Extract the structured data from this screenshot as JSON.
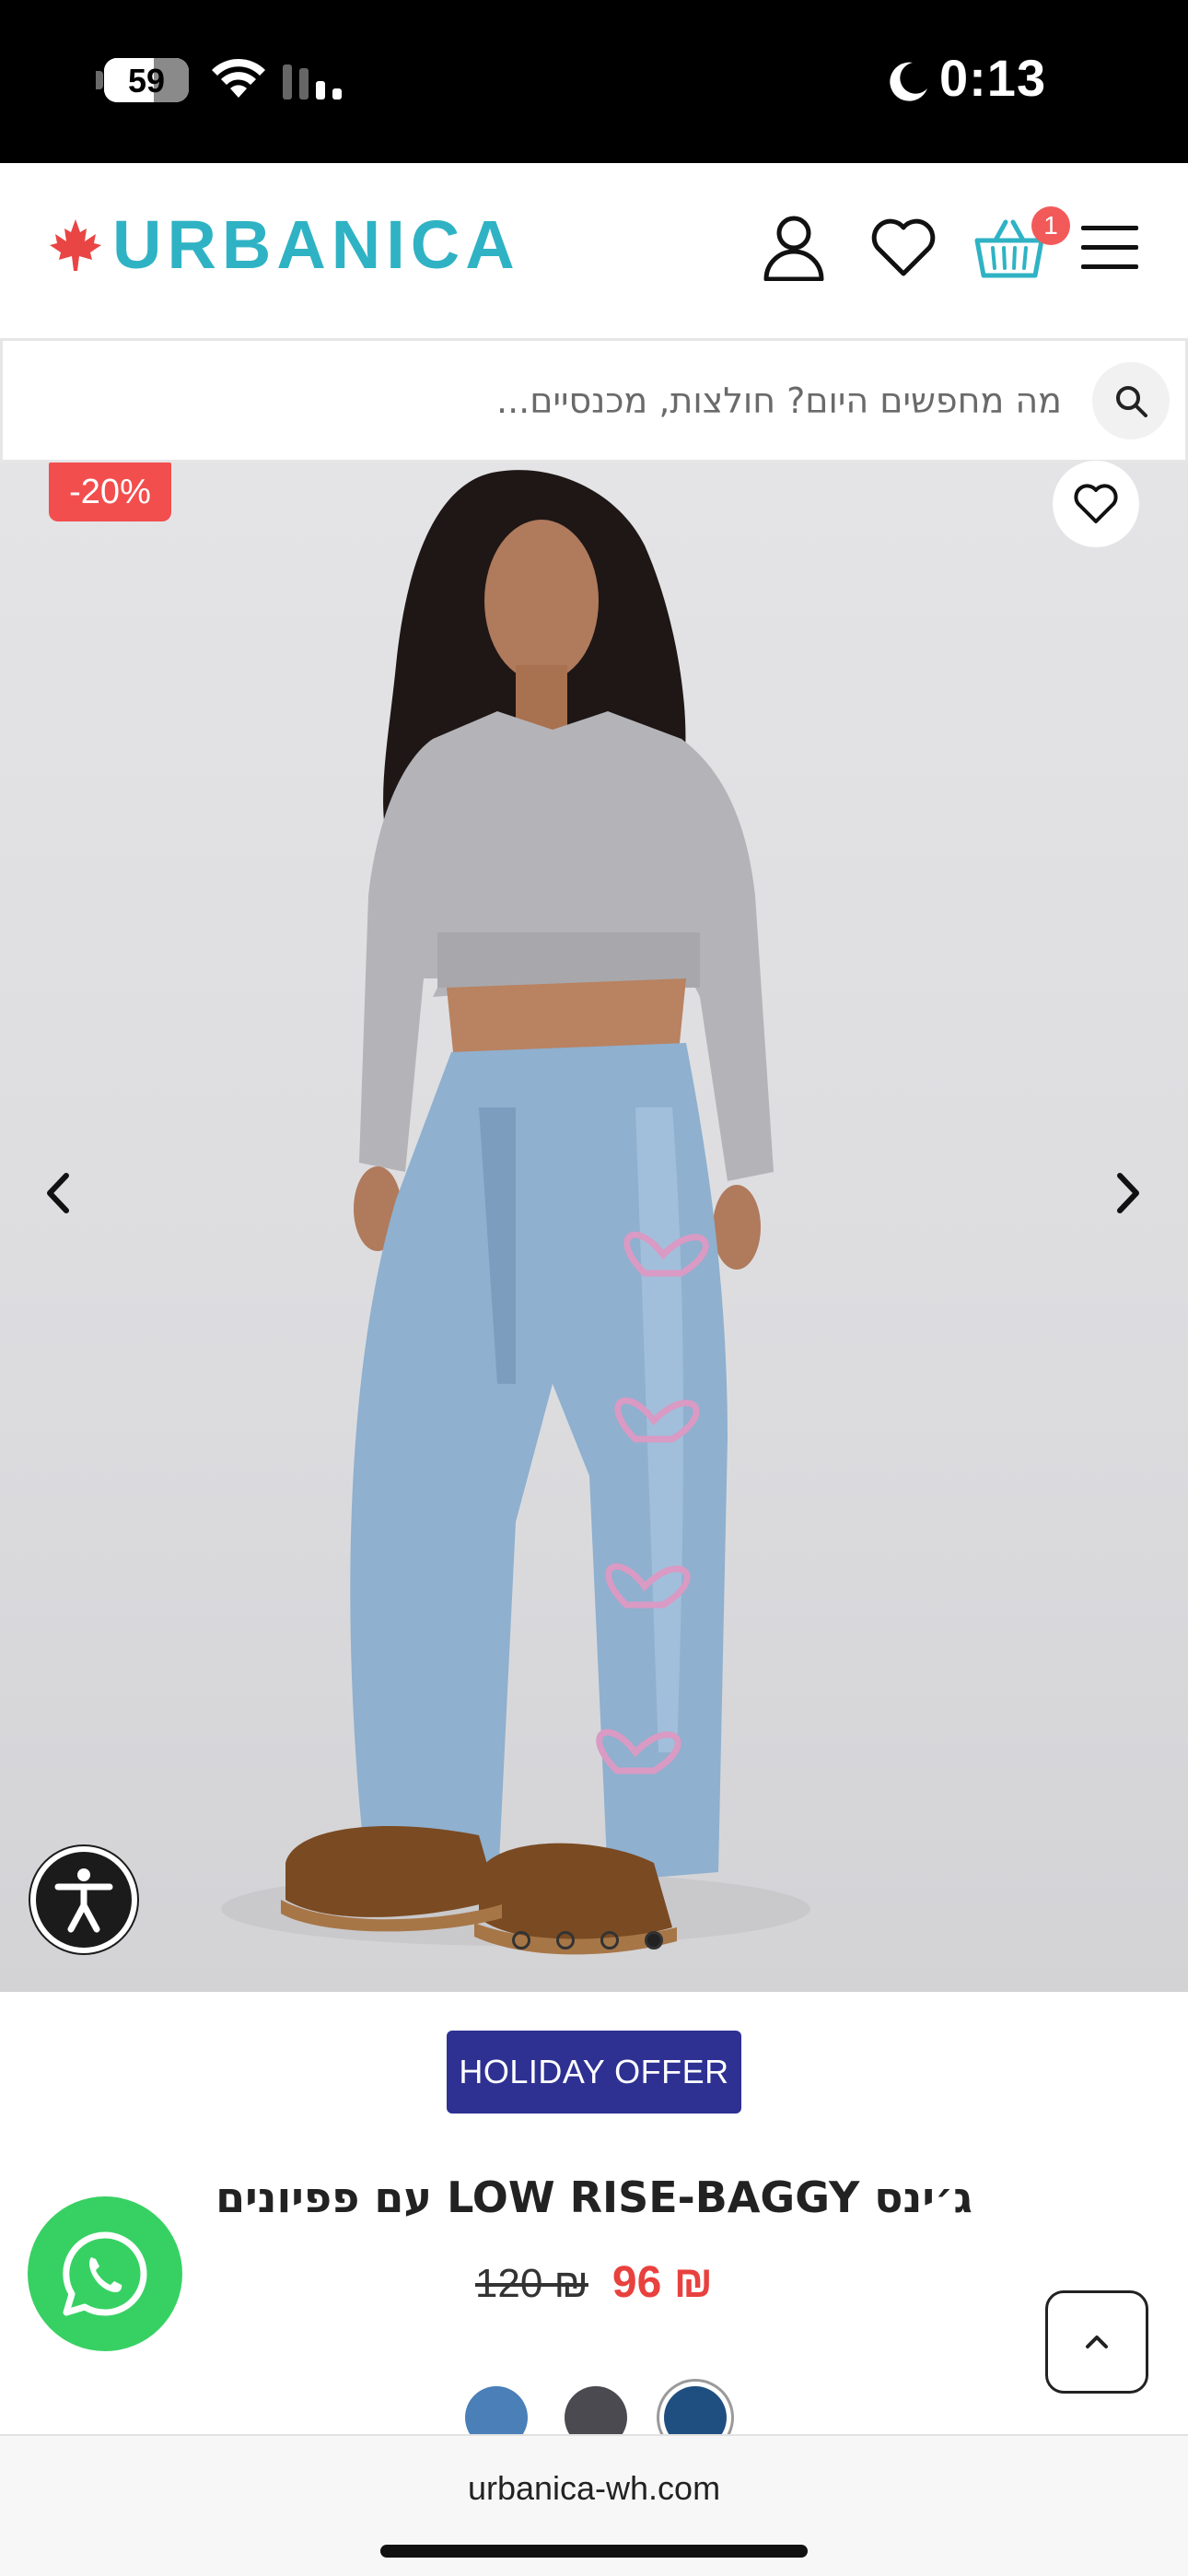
{
  "status_bar": {
    "time": "0:13",
    "battery": "59",
    "battery_level_percent": 59
  },
  "header": {
    "logo": "URBANICA",
    "cart_count": "1",
    "brand_color": "#2fb3c4"
  },
  "search": {
    "placeholder": "מה מחפשים היום? חולצות, מכנסיים..."
  },
  "gallery": {
    "discount": "-20%",
    "total_images": 4,
    "active_index": 3
  },
  "product": {
    "offer_label": "HOLIDAY OFFER",
    "title": "ג׳ינס LOW RISE-BAGGY עם פפיונים",
    "sale_price": "96 ₪",
    "old_price": "120 ₪",
    "swatch_colors": [
      "#4a7fb8",
      "#4b4a50",
      "#1f4f80"
    ],
    "selected_swatch_index": 2
  },
  "browser": {
    "url": "urbanica-wh.com"
  },
  "colors": {
    "sale_red": "#e8413e",
    "offer_blue": "#2e3192",
    "whatsapp_green": "#37d163"
  }
}
